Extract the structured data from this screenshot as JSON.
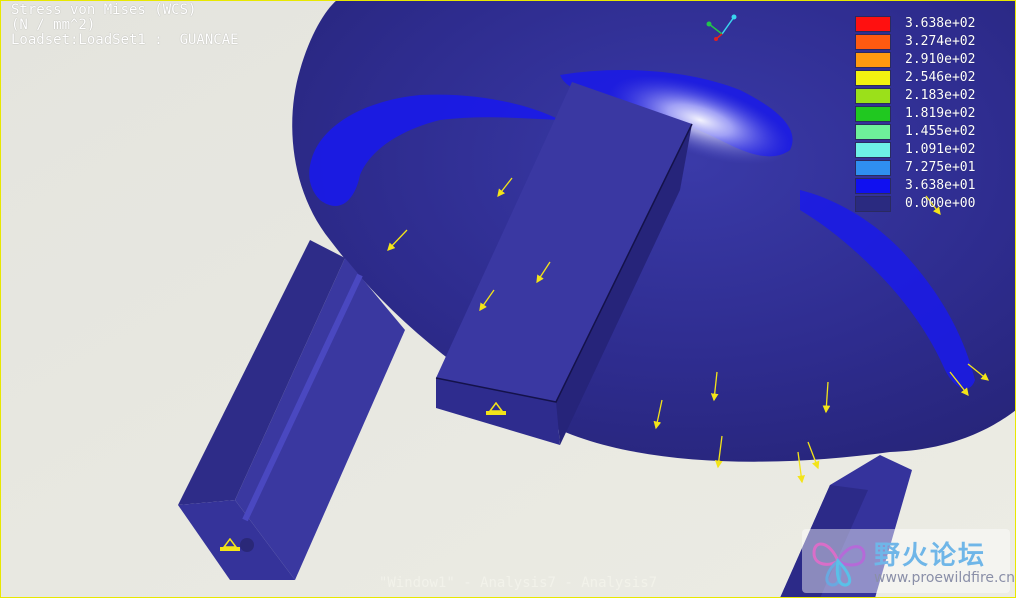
{
  "title_lines": [
    "Stress von Mises (WCS)",
    "(N / mm^2)",
    "Loadset:LoadSet1 :  GUANCAE"
  ],
  "legend": [
    {
      "label": "3.638e+02",
      "color": "#ff1010"
    },
    {
      "label": "3.274e+02",
      "color": "#ff5a10"
    },
    {
      "label": "2.910e+02",
      "color": "#ff9a10"
    },
    {
      "label": "2.546e+02",
      "color": "#f2f210"
    },
    {
      "label": "2.183e+02",
      "color": "#9be01a"
    },
    {
      "label": "1.819e+02",
      "color": "#20c820"
    },
    {
      "label": "1.455e+02",
      "color": "#6ef09a"
    },
    {
      "label": "1.091e+02",
      "color": "#6ef0e6"
    },
    {
      "label": "7.275e+01",
      "color": "#2f8ff0"
    },
    {
      "label": "3.638e+01",
      "color": "#1010f0"
    },
    {
      "label": "0.000e+00",
      "color": "#2a2a80"
    }
  ],
  "footer": "\"Window1\" - Analysis7 - Analysis7",
  "watermark": {
    "cn": "野火论坛",
    "url": "www.proewildfire.cn"
  },
  "colors": {
    "model_base": "#32309a",
    "stress_low": "#1a1aea",
    "highlight": "#ffffff",
    "background": "#e9e9e2",
    "load_arrow": "#f3e419"
  },
  "icons": [
    "coordinate-axes-icon",
    "constraint-icon",
    "load-arrow-icon",
    "watermark-logo-icon"
  ]
}
